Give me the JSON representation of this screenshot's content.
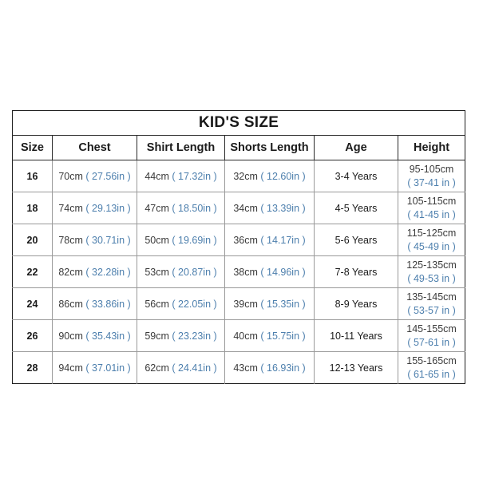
{
  "table": {
    "title": "KID'S SIZE",
    "columns": [
      {
        "key": "size",
        "label": "Size"
      },
      {
        "key": "chest",
        "label": "Chest"
      },
      {
        "key": "shirt",
        "label": "Shirt Length"
      },
      {
        "key": "shorts",
        "label": "Shorts Length"
      },
      {
        "key": "age",
        "label": "Age"
      },
      {
        "key": "height",
        "label": "Height"
      }
    ],
    "rows": [
      {
        "size": "16",
        "chest_cm": "70cm",
        "chest_in": "( 27.56in )",
        "shirt_cm": "44cm",
        "shirt_in": "( 17.32in )",
        "shorts_cm": "32cm",
        "shorts_in": "( 12.60in )",
        "age": "3-4 Years",
        "height_cm": "95-105cm",
        "height_in": "( 37-41 in )"
      },
      {
        "size": "18",
        "chest_cm": "74cm",
        "chest_in": "( 29.13in )",
        "shirt_cm": "47cm",
        "shirt_in": "( 18.50in )",
        "shorts_cm": "34cm",
        "shorts_in": "( 13.39in )",
        "age": "4-5 Years",
        "height_cm": "105-115cm",
        "height_in": "( 41-45 in )"
      },
      {
        "size": "20",
        "chest_cm": "78cm",
        "chest_in": "( 30.71in )",
        "shirt_cm": "50cm",
        "shirt_in": "( 19.69in )",
        "shorts_cm": "36cm",
        "shorts_in": "( 14.17in )",
        "age": "5-6 Years",
        "height_cm": "115-125cm",
        "height_in": "( 45-49 in )"
      },
      {
        "size": "22",
        "chest_cm": "82cm",
        "chest_in": "( 32.28in )",
        "shirt_cm": "53cm",
        "shirt_in": "( 20.87in )",
        "shorts_cm": "38cm",
        "shorts_in": "( 14.96in )",
        "age": "7-8 Years",
        "height_cm": "125-135cm",
        "height_in": "( 49-53 in )"
      },
      {
        "size": "24",
        "chest_cm": "86cm",
        "chest_in": "( 33.86in )",
        "shirt_cm": "56cm",
        "shirt_in": "( 22.05in )",
        "shorts_cm": "39cm",
        "shorts_in": "( 15.35in )",
        "age": "8-9 Years",
        "height_cm": "135-145cm",
        "height_in": "( 53-57 in )"
      },
      {
        "size": "26",
        "chest_cm": "90cm",
        "chest_in": "( 35.43in )",
        "shirt_cm": "59cm",
        "shirt_in": "( 23.23in )",
        "shorts_cm": "40cm",
        "shorts_in": "( 15.75in )",
        "age": "10-11 Years",
        "height_cm": "145-155cm",
        "height_in": "( 57-61 in )"
      },
      {
        "size": "28",
        "chest_cm": "94cm",
        "chest_in": "( 37.01in )",
        "shirt_cm": "62cm",
        "shirt_in": "( 24.41in )",
        "shorts_cm": "43cm",
        "shorts_in": "( 16.93in )",
        "age": "12-13 Years",
        "height_cm": "155-165cm",
        "height_in": "( 61-65 in )"
      }
    ]
  },
  "colors": {
    "background": "#ffffff",
    "text_dark": "#333333",
    "text_heading": "#111111",
    "inch_blue": "#4d7fad",
    "border_outer": "#1f1f1f",
    "border_inner": "#9a9a9a"
  }
}
